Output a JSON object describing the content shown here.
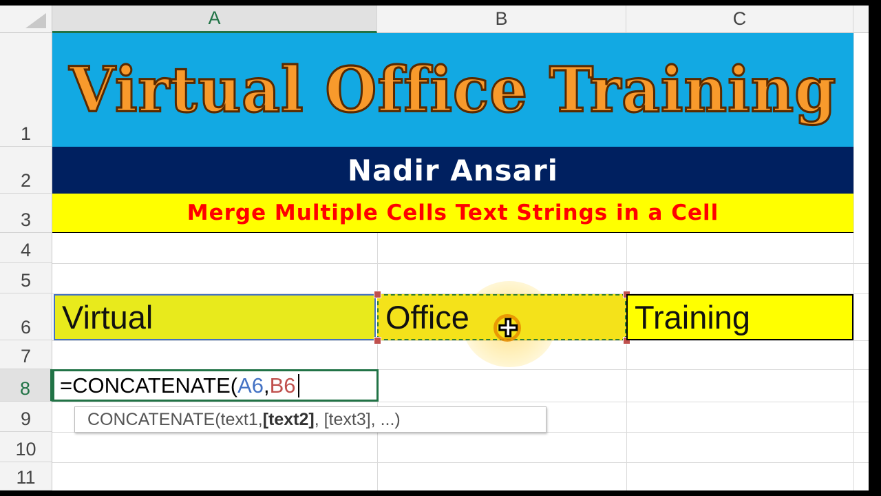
{
  "columns": [
    "A",
    "B",
    "C"
  ],
  "active_column": "A",
  "rows": [
    "1",
    "2",
    "3",
    "4",
    "5",
    "6",
    "7",
    "8",
    "9",
    "10",
    "11"
  ],
  "active_row": "8",
  "banner": {
    "title": "Virtual Office Training",
    "author": "Nadir Ansari",
    "subtitle": "Merge Multiple Cells Text Strings in a Cell"
  },
  "cells": {
    "A6": "Virtual",
    "B6": "Office",
    "C6": "Training"
  },
  "formula": {
    "prefix": "=CONCATENATE(",
    "ref1": "A6",
    "separator": ",",
    "ref2": "B6"
  },
  "tooltip": {
    "func": "CONCATENATE(",
    "arg1": "text1, ",
    "arg2_bold": "[text2]",
    "rest": ", [text3], ...)"
  },
  "colors": {
    "title_bg": "#12a9e3",
    "title_text": "#f89a2c",
    "author_bg": "#002060",
    "subtitle_bg": "#ffff00",
    "subtitle_text": "#ff0000",
    "selection_green": "#217346",
    "ref1_color": "#4472c4",
    "ref2_color": "#c0504d"
  }
}
